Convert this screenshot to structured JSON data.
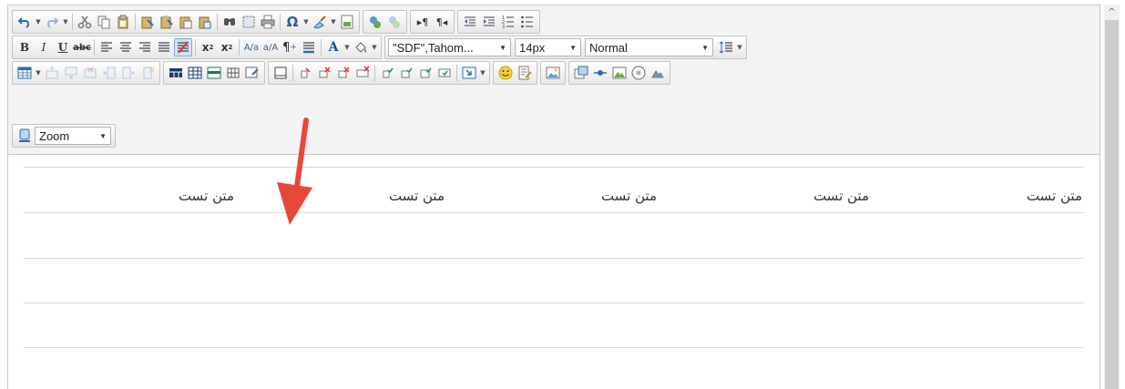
{
  "toolbar": {
    "font_family": "\"SDF\",Tahom...",
    "font_size": "14px",
    "format": "Normal",
    "zoom": "Zoom"
  },
  "content": {
    "cells": [
      "متن تست",
      "متن تست",
      "متن تست",
      "متن تست",
      "متن تست"
    ]
  },
  "colors": {
    "toolbar_bg": "#f3f3f3",
    "arrow": "#e8473b",
    "row_line": "#d9d9d9"
  }
}
